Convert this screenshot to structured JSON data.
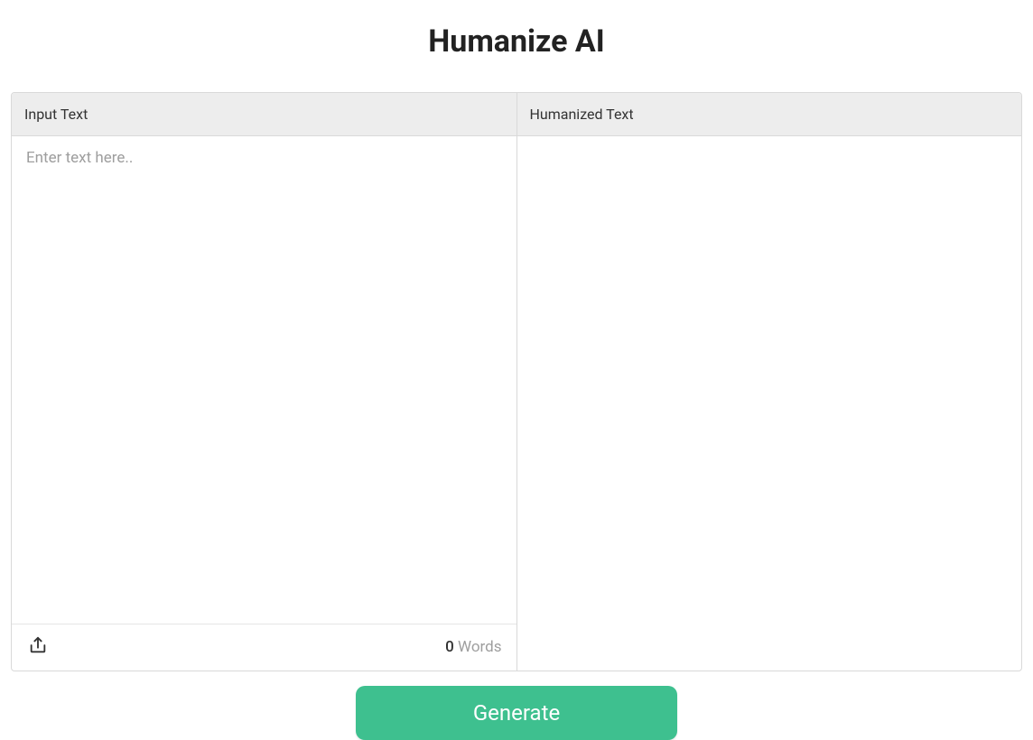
{
  "title": "Humanize AI",
  "input": {
    "header": "Input Text",
    "placeholder": "Enter text here..",
    "value": "",
    "word_count_number": "0",
    "word_count_label": " Words"
  },
  "output": {
    "header": "Humanized Text",
    "value": ""
  },
  "actions": {
    "generate_label": "Generate"
  }
}
